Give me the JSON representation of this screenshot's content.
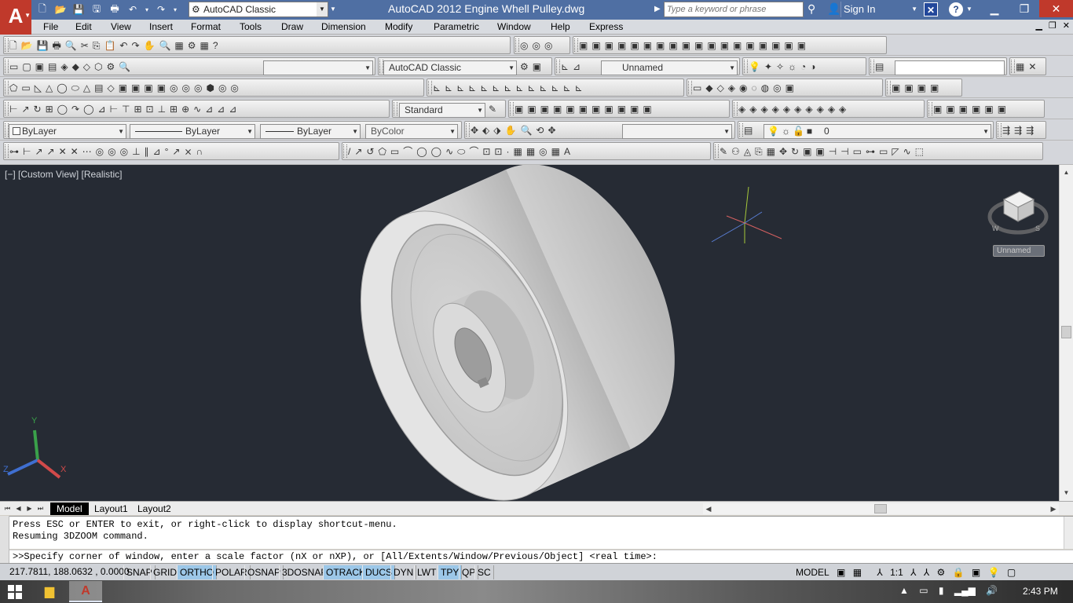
{
  "window": {
    "title": "AutoCAD 2012    Engine Whell Pulley.dwg",
    "logo_letter": "A",
    "workspace": "AutoCAD Classic",
    "search_placeholder": "Type a keyword or phrase",
    "sign_in": "Sign In"
  },
  "menu": [
    "File",
    "Edit",
    "View",
    "Insert",
    "Format",
    "Tools",
    "Draw",
    "Dimension",
    "Modify",
    "Parametric",
    "Window",
    "Help",
    "Express"
  ],
  "toolbars": {
    "workspace_combo": "AutoCAD Classic",
    "named_view": "Unnamed",
    "text_style": "Standard",
    "color": "ByLayer",
    "linetype": "ByLayer",
    "lineweight": "ByLayer",
    "plotstyle": "ByColor",
    "layer": "0"
  },
  "viewport": {
    "label": "[−] [Custom View] [Realistic]",
    "viewcube_caption": "Unnamed",
    "ucs_x": "X",
    "ucs_y": "Y",
    "ucs_z": "Z"
  },
  "tabs": [
    "Model",
    "Layout1",
    "Layout2"
  ],
  "command": {
    "history": [
      "Press ESC or ENTER to exit, or right-click to display shortcut-menu.",
      "Resuming 3DZOOM command."
    ],
    "prompt": ">>Specify corner of window, enter a scale factor (nX or nXP), or [All/Extents/Window/Previous/Object] <real time>:"
  },
  "status": {
    "coords": "217.7811, 188.0632 , 0.0000",
    "buttons": [
      {
        "label": "SNAP",
        "on": false
      },
      {
        "label": "GRID",
        "on": false
      },
      {
        "label": "ORTHO",
        "on": true
      },
      {
        "label": "POLAR",
        "on": false
      },
      {
        "label": "OSNAP",
        "on": false
      },
      {
        "label": "3DOSNAP",
        "on": false
      },
      {
        "label": "OTRACK",
        "on": true
      },
      {
        "label": "DUCS",
        "on": true
      },
      {
        "label": "DYN",
        "on": false
      },
      {
        "label": "LWT",
        "on": false
      },
      {
        "label": "TPY",
        "on": true
      },
      {
        "label": "QP",
        "on": false
      },
      {
        "label": "SC",
        "on": false
      }
    ],
    "model": "MODEL",
    "scale": "1:1"
  },
  "taskbar": {
    "clock": "2:43 PM"
  }
}
